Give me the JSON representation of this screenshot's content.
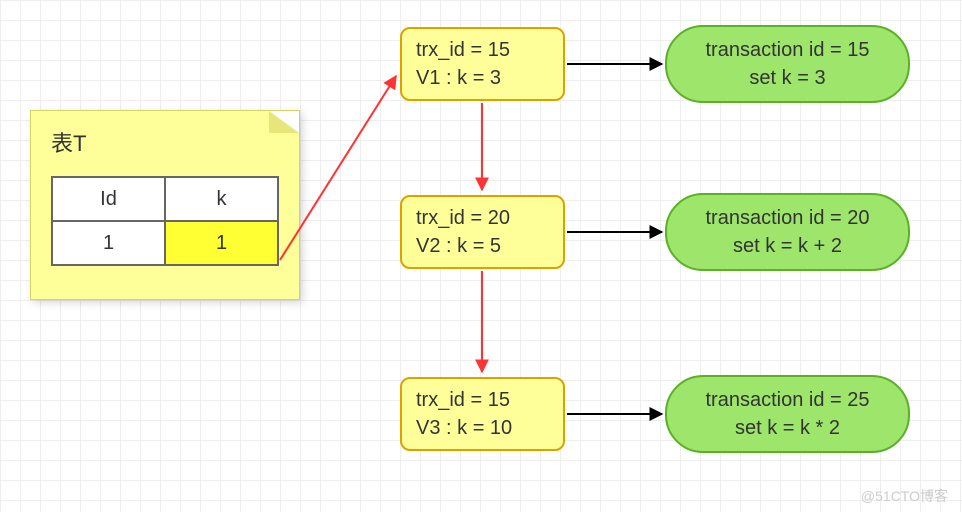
{
  "sticky": {
    "title": "表T",
    "headers": [
      "Id",
      "k"
    ],
    "row": [
      "1",
      "1"
    ]
  },
  "versions": [
    {
      "trx": "trx_id = 15",
      "val": "V1 : k = 3"
    },
    {
      "trx": "trx_id = 20",
      "val": "V2 : k = 5"
    },
    {
      "trx": "trx_id = 15",
      "val": "V3 : k = 10"
    }
  ],
  "txns": [
    {
      "id": "transaction id = 15",
      "op": "set k = 3"
    },
    {
      "id": "transaction id = 20",
      "op": "set k = k + 2"
    },
    {
      "id": "transaction id = 25",
      "op": "set k = k * 2"
    }
  ],
  "watermark": "@51CTO博客"
}
